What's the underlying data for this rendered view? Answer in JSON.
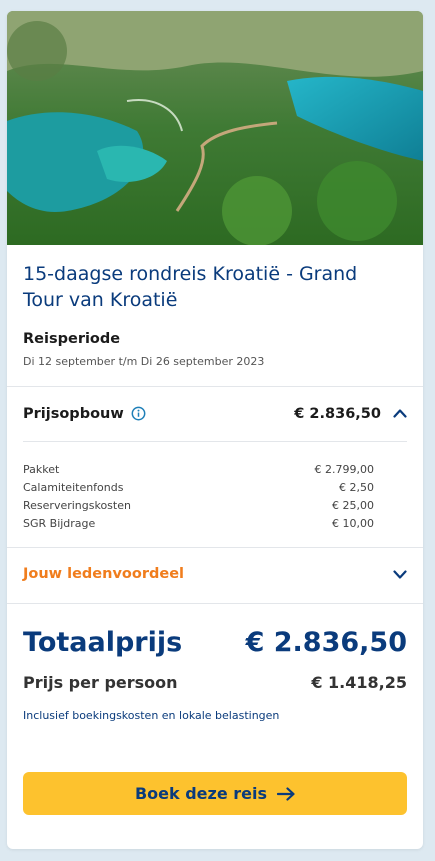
{
  "hero": {
    "image_icon": "waterfall-lake-landscape"
  },
  "trip": {
    "title": "15-daagse rondreis Kroatië - Grand Tour van Kroatië",
    "period_label": "Reisperiode",
    "period_dates": "Di 12 september t/m Di 26 september 2023"
  },
  "price": {
    "label": "Prijsopbouw",
    "info_icon": "info-icon",
    "total_small": "€ 2.836,50",
    "expanded": true,
    "breakdown": [
      {
        "label": "Pakket",
        "value": "€ 2.799,00"
      },
      {
        "label": "Calamiteitenfonds",
        "value": "€ 2,50"
      },
      {
        "label": "Reserveringskosten",
        "value": "€ 25,00"
      },
      {
        "label": "SGR Bijdrage",
        "value": "€ 10,00"
      }
    ]
  },
  "member": {
    "label": "Jouw ledenvoordeel",
    "expanded": false
  },
  "totals": {
    "total_label": "Totaalprijs",
    "total_value": "€ 2.836,50",
    "per_person_label": "Prijs per persoon",
    "per_person_value": "€ 1.418,25",
    "inclusive_note": "Inclusief boekingskosten en lokale belastingen"
  },
  "cta": {
    "label": "Boek deze reis",
    "icon": "arrow-right-icon"
  },
  "colors": {
    "brand_blue": "#0a3b7c",
    "accent_orange": "#f07d1d",
    "button_yellow": "#fdc22e",
    "page_bg": "#dde9f1"
  }
}
